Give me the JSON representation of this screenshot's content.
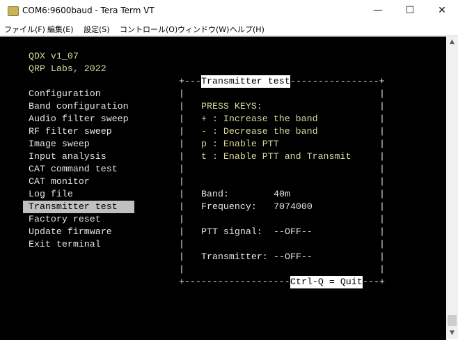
{
  "window": {
    "title": "COM6:9600baud - Tera Term VT",
    "minimize": "—",
    "maximize": "☐",
    "close": "✕"
  },
  "menubar": [
    "ファイル(F)",
    "編集(E)",
    "設定(S)",
    "コントロール(O)",
    "ウィンドウ(W)",
    "ヘルプ(H)"
  ],
  "terminal": {
    "header": [
      "QDX v1_07",
      "QRP Labs, 2022"
    ],
    "menu": [
      "Configuration",
      "Band configuration",
      "Audio filter sweep",
      "RF filter sweep",
      "Image sweep",
      "Input analysis",
      "CAT command test",
      "CAT monitor",
      "Log file",
      "Transmitter test",
      "Factory reset",
      "Update firmware",
      "Exit terminal"
    ],
    "selected_index": 9,
    "box": {
      "title": "Transmitter test",
      "press_keys": "PRESS KEYS:",
      "keys": [
        "+ : Increase the band",
        "- : Decrease the band",
        "p : Enable PTT",
        "t : Enable PTT and Transmit"
      ],
      "band_label": "Band:",
      "band_value": "40m",
      "freq_label": "Frequency:",
      "freq_value": "7074000",
      "ptt_label": "PTT signal:",
      "ptt_value": "--OFF--",
      "tx_label": "Transmitter:",
      "tx_value": "--OFF--",
      "footer": "Ctrl-Q = Quit"
    }
  },
  "colors": {
    "terminal_bg": "#000000",
    "text": "#e6e6e6",
    "accent_text": "#d8d89c",
    "selection": "#c0c0c0"
  }
}
